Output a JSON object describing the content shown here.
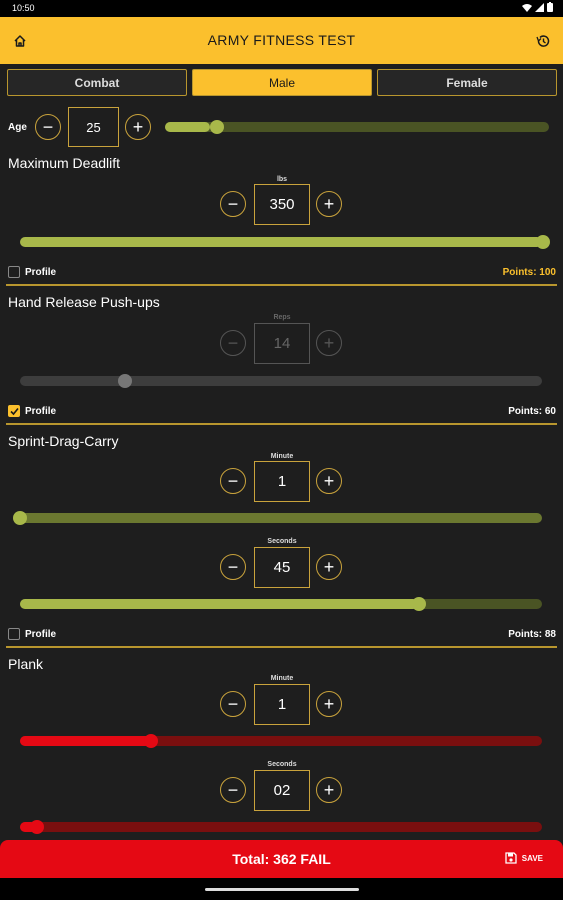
{
  "status_bar": {
    "time": "10:50"
  },
  "app_bar": {
    "title": "ARMY FITNESS TEST"
  },
  "tabs": [
    {
      "label": "Combat",
      "active": false
    },
    {
      "label": "Male",
      "active": true
    },
    {
      "label": "Female",
      "active": false
    }
  ],
  "age": {
    "label": "Age",
    "value": "25",
    "level": 0.12
  },
  "minus": "−",
  "plus": "+",
  "deadlift": {
    "title": "Maximum Deadlift",
    "unit": "lbs",
    "value": "350",
    "level": 1.0,
    "profile_label": "Profile",
    "profile_checked": false,
    "points": "Points: 100"
  },
  "pushups": {
    "title": "Hand Release Push-ups",
    "unit": "Reps",
    "value": "14",
    "level": 0.2,
    "profile_label": "Profile",
    "profile_checked": true,
    "points": "Points: 60"
  },
  "sdc": {
    "title": "Sprint-Drag-Carry",
    "minute_unit": "Minute",
    "minute_value": "1",
    "minute_level": 0.0,
    "seconds_unit": "Seconds",
    "seconds_value": "45",
    "seconds_level": 0.76,
    "profile_label": "Profile",
    "profile_checked": false,
    "points": "Points: 88"
  },
  "plank": {
    "title": "Plank",
    "minute_unit": "Minute",
    "minute_value": "1",
    "minute_level": 0.25,
    "seconds_unit": "Seconds",
    "seconds_value": "02",
    "seconds_level": 0.03
  },
  "footer": {
    "total": "Total: 362 FAIL",
    "save_label": "SAVE"
  },
  "colors": {
    "accent": "#fbc02d",
    "pass_green": "#a8b84a",
    "fail_red": "#e50914"
  }
}
